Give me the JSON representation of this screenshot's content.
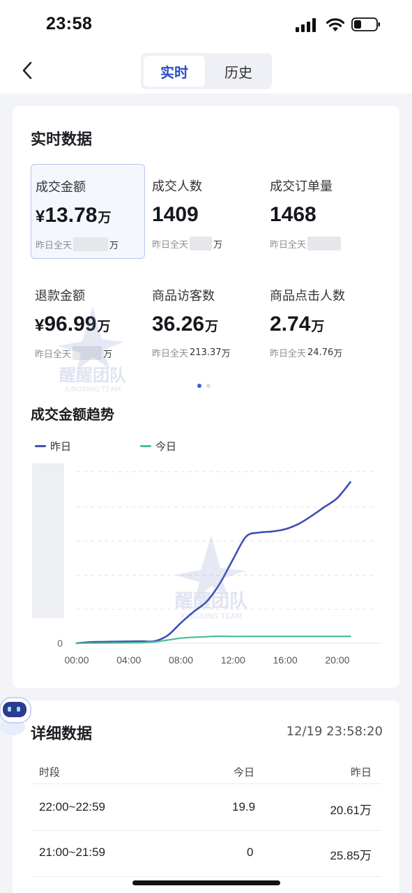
{
  "status_bar": {
    "time": "23:58"
  },
  "nav": {
    "tabs": [
      "实时",
      "历史"
    ],
    "active_tab": "实时"
  },
  "realtime": {
    "title": "实时数据",
    "metrics": [
      {
        "label": "成交金额",
        "prefix": "¥",
        "value": "13.78",
        "unit": "万",
        "sub_label": "昨日全天",
        "sub_value": "",
        "sub_unit": "万",
        "blurred": true,
        "selected": true
      },
      {
        "label": "成交人数",
        "prefix": "",
        "value": "1409",
        "unit": "",
        "sub_label": "昨日全天",
        "sub_value": "",
        "sub_unit": "万",
        "blurred": true,
        "selected": false
      },
      {
        "label": "成交订单量",
        "prefix": "",
        "value": "1468",
        "unit": "",
        "sub_label": "昨日全天",
        "sub_value": "",
        "sub_unit": "",
        "blurred": true,
        "selected": false
      },
      {
        "label": "退款金额",
        "prefix": "¥",
        "value": "96.99",
        "unit": "万",
        "sub_label": "昨日全天",
        "sub_value": "",
        "sub_unit": "万",
        "blurred": true,
        "selected": false
      },
      {
        "label": "商品访客数",
        "prefix": "",
        "value": "36.26",
        "unit": "万",
        "sub_label": "昨日全天",
        "sub_value": "213.37",
        "sub_unit": "万",
        "blurred": false,
        "selected": false
      },
      {
        "label": "商品点击人数",
        "prefix": "",
        "value": "2.74",
        "unit": "万",
        "sub_label": "昨日全天",
        "sub_value": "24.76",
        "sub_unit": "万",
        "blurred": false,
        "selected": false
      }
    ]
  },
  "watermark": {
    "text": "醒醒团队",
    "subtext": "XINGXING TEAM"
  },
  "trend": {
    "title": "成交金额趋势",
    "colors": {
      "yesterday": "#3d4fb5",
      "today": "#4dbf93"
    }
  },
  "chart_data": {
    "type": "line",
    "x": [
      "00:00",
      "01:00",
      "02:00",
      "03:00",
      "04:00",
      "05:00",
      "06:00",
      "07:00",
      "08:00",
      "09:00",
      "10:00",
      "11:00",
      "12:00",
      "13:00",
      "14:00",
      "15:00",
      "16:00",
      "17:00",
      "18:00",
      "19:00",
      "20:00",
      "21:00",
      "22:00",
      "23:00"
    ],
    "x_ticks": [
      "00:00",
      "04:00",
      "08:00",
      "12:00",
      "16:00",
      "20:00"
    ],
    "y_ticks": [
      "0"
    ],
    "series": [
      {
        "name": "昨日",
        "values": [
          0.0,
          0.1,
          0.12,
          0.14,
          0.16,
          0.17,
          0.19,
          0.7,
          1.8,
          2.8,
          3.7,
          5.3,
          7.4,
          9.4,
          9.75,
          9.85,
          10.05,
          10.5,
          11.2,
          12.0,
          12.8,
          14.2
        ]
      },
      {
        "name": "今日",
        "values": [
          0.0,
          0.01,
          0.02,
          0.03,
          0.04,
          0.06,
          0.12,
          0.28,
          0.45,
          0.53,
          0.58,
          0.62,
          0.6,
          0.61,
          0.61,
          0.61,
          0.61,
          0.61,
          0.61,
          0.61,
          0.61,
          0.61
        ]
      }
    ],
    "legend": "top-left",
    "grid": true
  },
  "detail": {
    "title": "详细数据",
    "timestamp": "12/19 23:58:20",
    "columns": [
      "时段",
      "今日",
      "昨日"
    ],
    "rows": [
      {
        "period": "22:00~22:59",
        "today": "19.9",
        "yesterday": "20.61万"
      },
      {
        "period": "21:00~21:59",
        "today": "0",
        "yesterday": "25.85万"
      }
    ]
  }
}
